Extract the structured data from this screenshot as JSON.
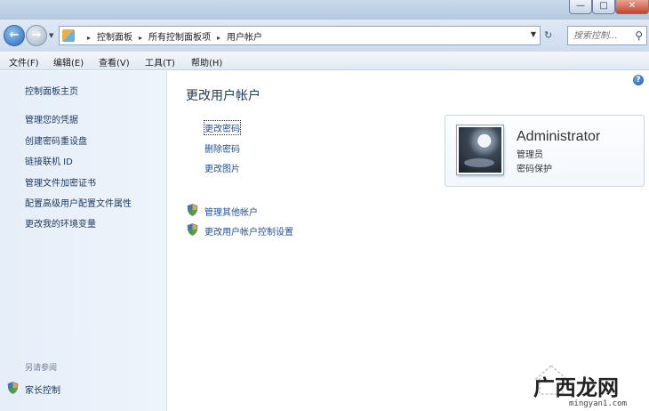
{
  "window": {
    "minimize_glyph": "—",
    "maximize_glyph": "□",
    "close_glyph": "✕"
  },
  "address_bar": {
    "breadcrumbs": [
      "控制面板",
      "所有控制面板项",
      "用户帐户"
    ],
    "separator": "▸",
    "search_placeholder": "搜索控制..."
  },
  "menu": {
    "items": [
      "文件(F)",
      "编辑(E)",
      "查看(V)",
      "工具(T)",
      "帮助(H)"
    ]
  },
  "sidebar": {
    "home": "控制面板主页",
    "links": [
      "管理您的凭据",
      "创建密码重设盘",
      "链接联机 ID",
      "管理文件加密证书",
      "配置高级用户配置文件属性",
      "更改我的环境变量"
    ],
    "see_also_heading": "另请参阅",
    "parental_controls": "家长控制"
  },
  "main": {
    "title": "更改用户帐户",
    "tasks": [
      "更改密码",
      "删除密码",
      "更改图片"
    ],
    "shield_tasks": [
      "管理其他帐户",
      "更改用户帐户控制设置"
    ],
    "help_glyph": "?"
  },
  "account": {
    "name": "Administrator",
    "role": "管理员",
    "status": "密码保护"
  },
  "watermark": {
    "brand": "广西龙网",
    "url": "mingyan1.com"
  },
  "colors": {
    "link": "#1f4f9c",
    "sidebar_bg": "#e6eef9",
    "accent": "#2b68b4"
  }
}
